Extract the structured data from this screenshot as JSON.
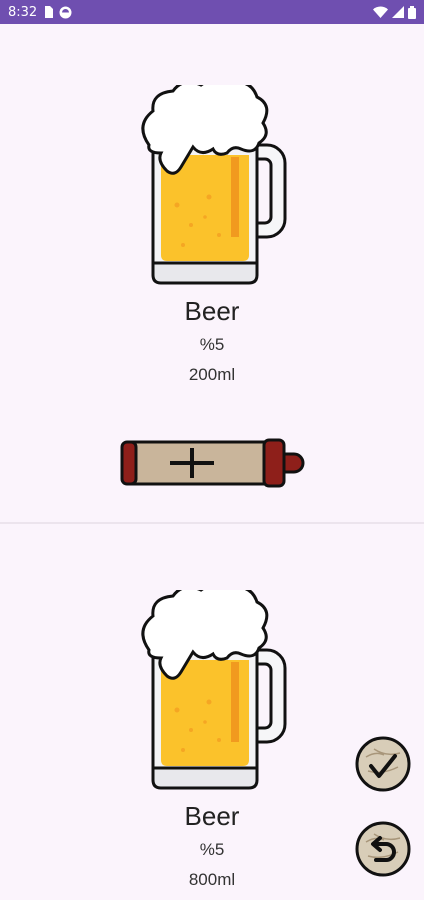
{
  "status_bar": {
    "time": "8:32",
    "icons": [
      "sim-card-icon",
      "app-notification-icon",
      "wifi-icon",
      "signal-icon",
      "battery-icon"
    ]
  },
  "current_drink": {
    "image": "beer-mug-icon",
    "name": "Beer",
    "abv": "%5",
    "volume": "200ml"
  },
  "add_button": {
    "icon": "plus-icon"
  },
  "history_drink": {
    "image": "beer-mug-icon",
    "name": "Beer",
    "abv": "%5",
    "volume": "800ml"
  },
  "actions": {
    "confirm_icon": "checkmark-icon",
    "undo_icon": "undo-icon"
  }
}
